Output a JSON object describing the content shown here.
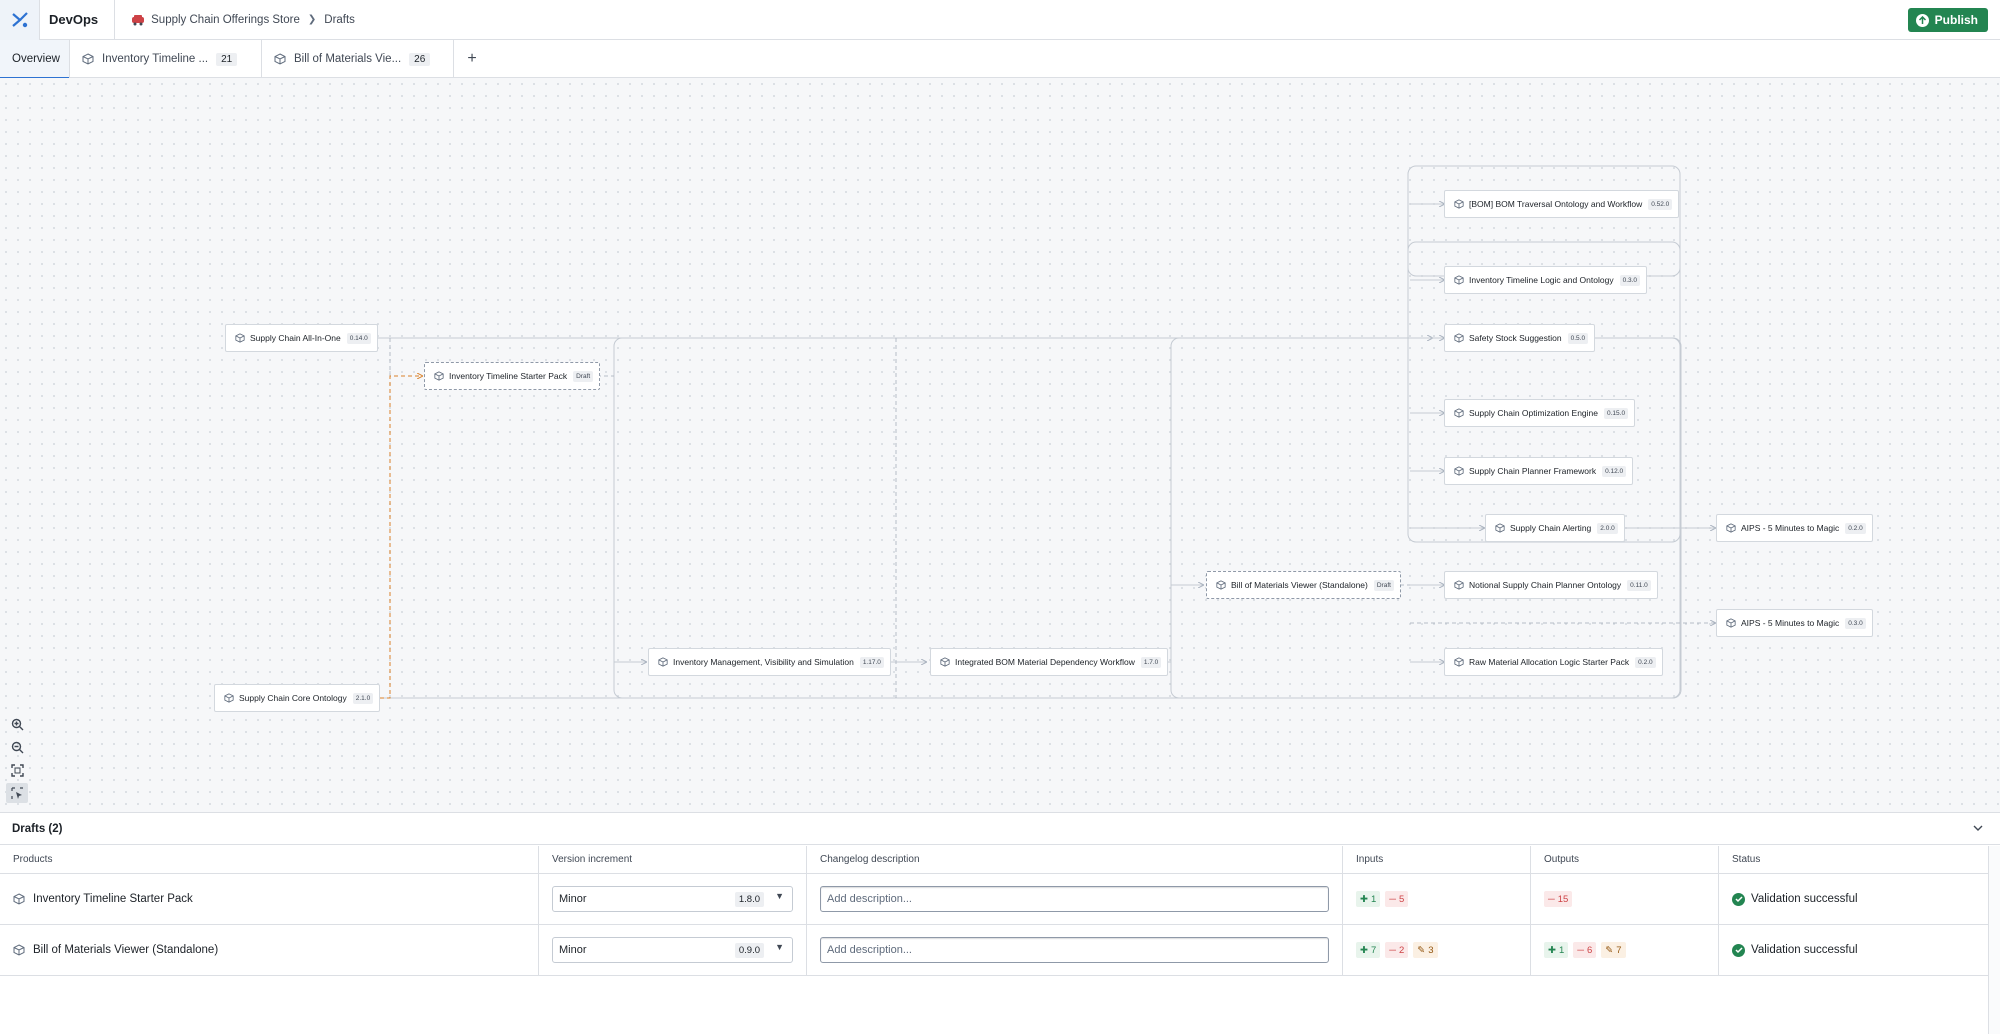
{
  "app": {
    "name": "DevOps"
  },
  "breadcrumb": {
    "store": "Supply Chain Offerings Store",
    "current": "Drafts"
  },
  "publish_label": "Publish",
  "tabs": [
    {
      "label": "Overview"
    },
    {
      "label": "Inventory Timeline ...",
      "count": "21"
    },
    {
      "label": "Bill of Materials Vie...",
      "count": "26"
    }
  ],
  "nodes": {
    "sc_all_in_one": {
      "name": "Supply Chain All-In-One",
      "version": "0.14.0"
    },
    "inv_timeline_starter": {
      "name": "Inventory Timeline Starter Pack",
      "version": "Draft"
    },
    "sc_core_ontology": {
      "name": "Supply Chain Core Ontology",
      "version": "2.1.0"
    },
    "inv_mgmt": {
      "name": "Inventory Management, Visibility and Simulation",
      "version": "1.17.0"
    },
    "integrated_bom": {
      "name": "Integrated BOM Material Dependency Workflow",
      "version": "1.7.0"
    },
    "bom_viewer": {
      "name": "Bill of Materials Viewer (Standalone)",
      "version": "Draft"
    },
    "bom_traversal": {
      "name": "[BOM] BOM Traversal Ontology and Workflow",
      "version": "0.52.0"
    },
    "inv_timeline_logic": {
      "name": "Inventory Timeline Logic and Ontology",
      "version": "0.3.0"
    },
    "safety_stock": {
      "name": "Safety Stock Suggestion",
      "version": "0.5.0"
    },
    "sc_optimization": {
      "name": "Supply Chain Optimization Engine",
      "version": "0.15.0"
    },
    "sc_planner": {
      "name": "Supply Chain Planner Framework",
      "version": "0.12.0"
    },
    "sc_alerting": {
      "name": "Supply Chain Alerting",
      "version": "2.0.0"
    },
    "notional_planner": {
      "name": "Notional Supply Chain Planner Ontology",
      "version": "0.11.0"
    },
    "raw_material": {
      "name": "Raw Material Allocation Logic Starter Pack",
      "version": "0.2.0"
    },
    "aips_a": {
      "name": "AIPS - 5 Minutes to Magic",
      "version": "0.2.0"
    },
    "aips_b": {
      "name": "AIPS - 5 Minutes to Magic",
      "version": "0.3.0"
    }
  },
  "drafts": {
    "title": "Drafts (2)",
    "columns": [
      "Products",
      "Version increment",
      "Changelog description",
      "Inputs",
      "Outputs",
      "Status"
    ],
    "rows": [
      {
        "product": "Inventory Timeline Starter Pack",
        "increment": "Minor",
        "version": "1.8.0",
        "placeholder": "Add description...",
        "inputs": {
          "added": "1",
          "removed": "5"
        },
        "outputs": {
          "removed": "15"
        },
        "status": "Validation successful"
      },
      {
        "product": "Bill of Materials Viewer (Standalone)",
        "increment": "Minor",
        "version": "0.9.0",
        "placeholder": "Add description...",
        "inputs": {
          "added": "7",
          "removed": "2",
          "modified": "3"
        },
        "outputs": {
          "added": "1",
          "removed": "6",
          "modified": "7"
        },
        "status": "Validation successful"
      }
    ]
  },
  "colors": {
    "accent": "#2d72d2",
    "success": "#238551",
    "danger": "#cd4246",
    "draft_edge": "#d9822b"
  }
}
